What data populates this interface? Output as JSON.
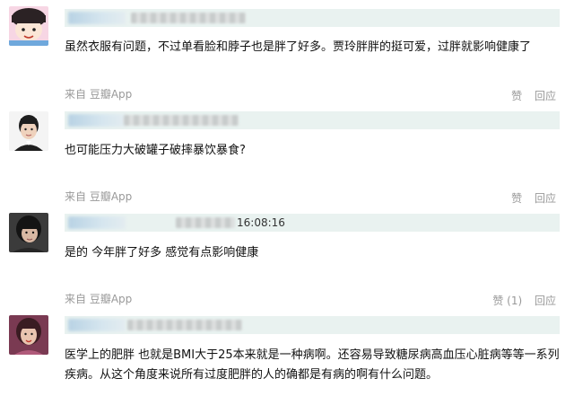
{
  "comments": [
    {
      "time": "",
      "text": "虽然衣服有问题，不过单看脸和脖子也是胖了好多。贾玲胖胖的挺可爱，过胖就影响健康了",
      "source": "来自 豆瓣App",
      "like_label": "赞",
      "reply_label": "回应",
      "avatar_icon": "cartoon-girl-avatar-icon"
    },
    {
      "time": "",
      "text": "也可能压力大破罐子破摔暴饮暴食?",
      "source": "来自 豆瓣App",
      "like_label": "赞",
      "reply_label": "回应",
      "avatar_icon": "boy-portrait-avatar-icon"
    },
    {
      "time": "16:08:16",
      "text": "是的 今年胖了好多 感觉有点影响健康",
      "source": "来自 豆瓣App",
      "like_label": "赞 (1)",
      "reply_label": "回应",
      "avatar_icon": "person-portrait-avatar-icon"
    },
    {
      "time": "",
      "text": "医学上的肥胖 也就是BMI大于25本来就是一种病啊。还容易导致糖尿病高血压心脏病等等一系列疾病。从这个角度来说所有过度肥胖的人的确都是有病的啊有什么问题。",
      "source": "",
      "like_label": "",
      "reply_label": "",
      "avatar_icon": "woman-portrait-avatar-icon"
    }
  ]
}
